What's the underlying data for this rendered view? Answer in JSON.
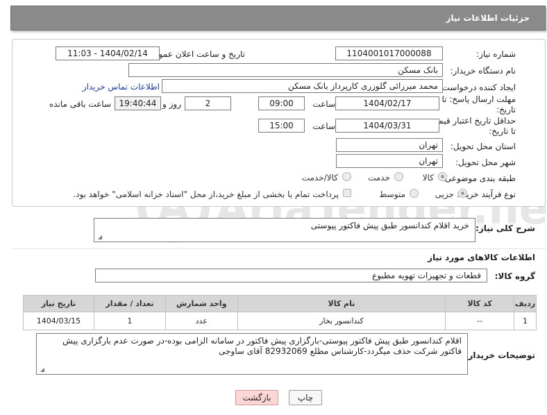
{
  "header": {
    "title": "جزئیات اطلاعات نیاز"
  },
  "form": {
    "need_number": {
      "label": "شماره نیاز:",
      "value": "1104001017000088"
    },
    "announce": {
      "label": "تاریخ و ساعت اعلان عمومی:",
      "value": "1404/02/14 - 11:03"
    },
    "buyer_org": {
      "label": "نام دستگاه خریدار:",
      "value": "بانک مسکن"
    },
    "requester": {
      "label": "ایجاد کننده درخواست:",
      "value": "محمد میرزائی گلوزری کارپرداز بانک مسکن",
      "contact_link": "اطلاعات تماس خریدار"
    },
    "reply_deadline": {
      "label_line1": "مهلت ارسال پاسخ: تا",
      "label_line2": "تاریخ:",
      "date": "1404/02/17",
      "time_label": "ساعت",
      "time": "09:00",
      "days": "2",
      "days_label": "روز و",
      "remaining": "19:40:44",
      "remaining_label": "ساعت باقی مانده"
    },
    "price_validity": {
      "label_line1": "حداقل تاریخ اعتبار قیمت:",
      "label_line2": "تا تاریخ:",
      "date": "1404/03/31",
      "time_label": "ساعت",
      "time": "15:00"
    },
    "province": {
      "label": "استان محل تحویل:",
      "value": "تهران"
    },
    "city": {
      "label": "شهر محل تحویل:",
      "value": "تهران"
    },
    "category": {
      "label": "طبقه بندی موضوعی:",
      "options": [
        "کالا",
        "خدمت",
        "کالا/خدمت"
      ],
      "selected": "کالا"
    },
    "process": {
      "label": "نوع فرآیند خرید :",
      "options": [
        "جزیی",
        "متوسط"
      ],
      "selected": "جزیی",
      "payment_note": "پرداخت تمام یا بخشی از مبلغ خرید،از محل \"اسناد خزانه اسلامی\" خواهد بود."
    }
  },
  "need_summary": {
    "label": "شرح کلی نیاز:",
    "value": "خرید اقلام کندانسور طبق پیش فاکتور پیوستی"
  },
  "goods_info": {
    "title": "اطلاعات کالاهای مورد نیاز"
  },
  "goods_group": {
    "label": "گروه کالا:",
    "value": "قطعات و تجهیزات تهویه مطبوع"
  },
  "items_table": {
    "columns": [
      "ردیف",
      "کد کالا",
      "نام کالا",
      "واحد شمارش",
      "تعداد / مقدار",
      "تاریخ نیاز"
    ],
    "rows": [
      [
        "1",
        "--",
        "کندانسور بخار",
        "عدد",
        "1",
        "1404/03/15"
      ]
    ]
  },
  "buyer_notes": {
    "label": "توضیحات خریدار:",
    "value": "اقلام کندانسور طبق پیش فاکتور پیوستی-بارگزاری پیش فاکتور در سامانه الزامی بوده-در صورت عدم بارگزاری پیش فاکتور شرکت حذف میگردد-کارشناس مطلع 82932069 آقای ساوجی"
  },
  "buttons": {
    "print": "چاپ",
    "back": "بازگشت"
  },
  "watermark": {
    "text": "AriaTender.neT"
  },
  "colors": {
    "header_bg": "#8a8a8a",
    "link": "#1a3f9a",
    "back_button": "#ffd6d6",
    "table_header": "#d6d6d6"
  },
  "icons": {
    "resize_handle": "resize-grip-icon",
    "watermark_logo": "ariatender-logo-icon"
  }
}
